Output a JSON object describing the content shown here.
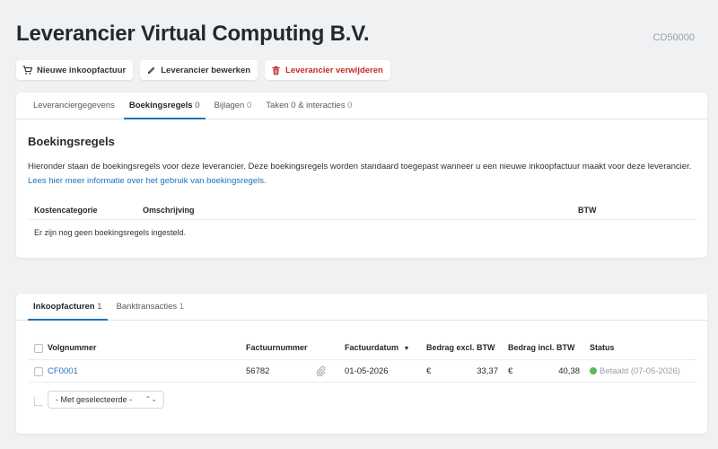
{
  "header": {
    "title": "Leverancier Virtual Computing B.V.",
    "code": "CD50000"
  },
  "toolbar": {
    "new_invoice": "Nieuwe inkoopfactuur",
    "edit_supplier": "Leverancier bewerken",
    "delete_supplier": "Leverancier verwijderen"
  },
  "tabs": [
    {
      "label": "Leveranciergegevens",
      "count": ""
    },
    {
      "label": "Boekingsregels",
      "count": "0"
    },
    {
      "label": "Bijlagen",
      "count": "0"
    },
    {
      "label": "Taken 0 & interacties",
      "count": "0"
    }
  ],
  "rules": {
    "title": "Boekingsregels",
    "description": "Hieronder staan de boekingsregels voor deze leverancier. Deze boekingsregels worden standaard toegepast wanneer u een nieuwe inkoopfactuur maakt voor deze leverancier.",
    "link": "Lees hier meer informatie over het gebruik van boekingsregels.",
    "columns": {
      "category": "Kostencategorie",
      "description": "Omschrijving",
      "vat": "BTW"
    },
    "empty": "Er zijn nog geen boekingsregels ingesteld."
  },
  "invoice_tabs": [
    {
      "label": "Inkoopfacturen",
      "count": "1"
    },
    {
      "label": "Banktransacties",
      "count": "1"
    }
  ],
  "invoices": {
    "columns": {
      "number": "Volgnummer",
      "invoice_number": "Factuurnummer",
      "date": "Factuurdatum",
      "excl": "Bedrag excl. BTW",
      "incl": "Bedrag incl. BTW",
      "status": "Status"
    },
    "rows": [
      {
        "number": "CF0001",
        "invoice_number": "56782",
        "date": "01-05-2026",
        "currency": "€",
        "excl": "33,37",
        "incl": "40,38",
        "status": "Betaald (07-05-2026)",
        "status_color": "#5cb85c"
      }
    ],
    "bulk_action": "- Met geselecteerde -"
  }
}
